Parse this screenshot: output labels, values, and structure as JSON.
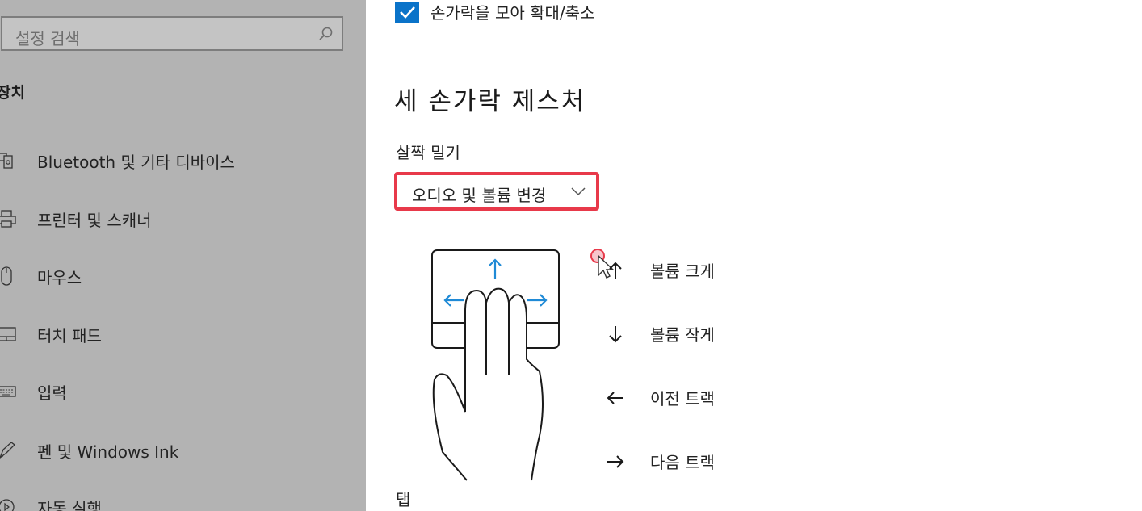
{
  "sidebar": {
    "search": {
      "placeholder": "설정 검색",
      "icon": "search-icon"
    },
    "section_title": "장치",
    "items": [
      {
        "label": "Bluetooth 및 기타 디바이스",
        "icon": "bluetooth-devices-icon"
      },
      {
        "label": "프린터 및 스캐너",
        "icon": "printer-icon"
      },
      {
        "label": "마우스",
        "icon": "mouse-icon"
      },
      {
        "label": "터치 패드",
        "icon": "touchpad-icon"
      },
      {
        "label": "입력",
        "icon": "keyboard-icon"
      },
      {
        "label": "펜 및 Windows Ink",
        "icon": "pen-icon"
      },
      {
        "label": "자동 실행",
        "icon": "autoplay-icon"
      }
    ]
  },
  "main": {
    "pinch_checkbox": {
      "label": "손가락을 모아 확대/축소",
      "checked": true
    },
    "heading": "세 손가락 제스처",
    "swipe": {
      "label": "살짝 밀기",
      "selected": "오디오 및 볼륨 변경"
    },
    "gestures": [
      {
        "arrow": "arrow-up-icon",
        "label": "볼륨 크게"
      },
      {
        "arrow": "arrow-down-icon",
        "label": "볼륨 작게"
      },
      {
        "arrow": "arrow-left-icon",
        "label": "이전 트랙"
      },
      {
        "arrow": "arrow-right-icon",
        "label": "다음 트랙"
      }
    ],
    "tap_label": "탭"
  },
  "colors": {
    "sidebar_bg": "#b3b3b3",
    "accent_blue": "#0a73c9",
    "highlight_red": "#e8394a",
    "gesture_arrow_blue": "#1f8ad6"
  }
}
